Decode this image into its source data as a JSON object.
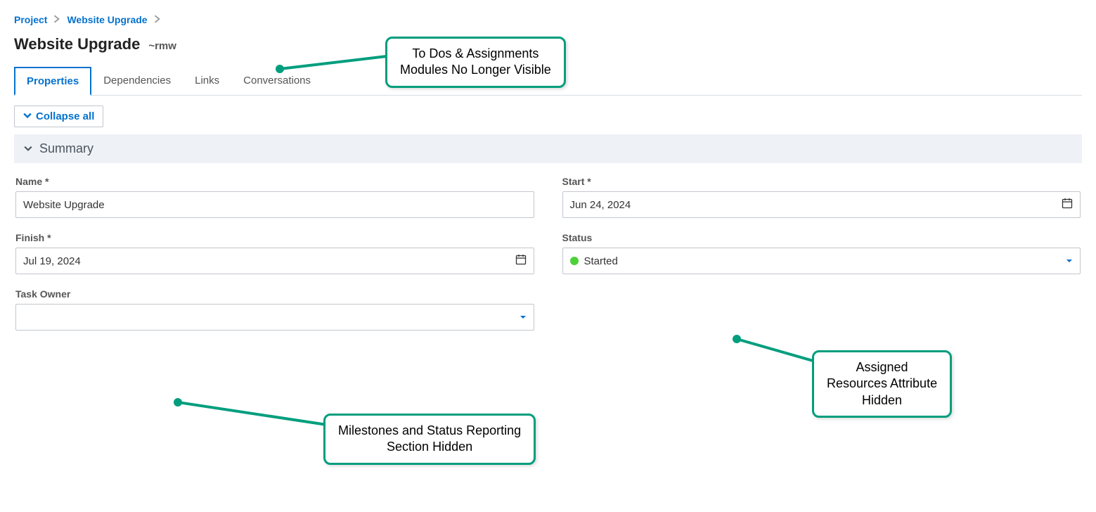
{
  "breadcrumb": {
    "item1": "Project",
    "item2": "Website Upgrade"
  },
  "header": {
    "title": "Website Upgrade",
    "subtitle": "~rmw"
  },
  "tabs": {
    "t0": "Properties",
    "t1": "Dependencies",
    "t2": "Links",
    "t3": "Conversations"
  },
  "actions": {
    "collapse_all": "Collapse all"
  },
  "sections": {
    "summary": "Summary"
  },
  "fields": {
    "name_label": "Name *",
    "name_value": "Website Upgrade",
    "start_label": "Start *",
    "start_value": "Jun 24, 2024",
    "finish_label": "Finish *",
    "finish_value": "Jul 19, 2024",
    "status_label": "Status",
    "status_value": "Started",
    "taskowner_label": "Task Owner",
    "taskowner_value": ""
  },
  "callouts": {
    "c1_l1": "To Dos & Assignments",
    "c1_l2": "Modules No Longer Visible",
    "c2_l1": "Milestones and Status Reporting",
    "c2_l2": "Section Hidden",
    "c3_l1": "Assigned",
    "c3_l2": "Resources Attribute",
    "c3_l3": "Hidden"
  },
  "colors": {
    "accent_teal": "#009e7e",
    "link_blue": "#0572ce",
    "status_green": "#4cd137"
  }
}
